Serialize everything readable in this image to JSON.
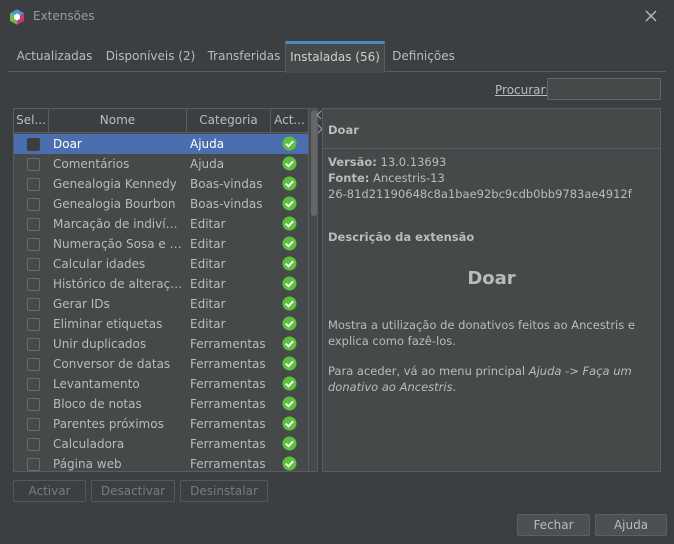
{
  "window": {
    "title": "Extensões"
  },
  "tabs": [
    {
      "label": "Actualizadas"
    },
    {
      "label": "Disponíveis (2)"
    },
    {
      "label": "Transferidas"
    },
    {
      "label": "Instaladas (56)"
    },
    {
      "label": "Definições"
    }
  ],
  "search": {
    "label": "Procurar:",
    "value": ""
  },
  "table": {
    "columns": [
      "Sel...",
      "Nome",
      "Categoria",
      "Act..."
    ],
    "rows": [
      {
        "name": "Doar",
        "category": "Ajuda",
        "selected": true
      },
      {
        "name": "Comentários",
        "category": "Ajuda"
      },
      {
        "name": "Genealogia Kennedy",
        "category": "Boas-vindas"
      },
      {
        "name": "Genealogia Bourbon",
        "category": "Boas-vindas"
      },
      {
        "name": "Marcação de indivíduo...",
        "category": "Editar"
      },
      {
        "name": "Numeração Sosa e d'A...",
        "category": "Editar"
      },
      {
        "name": "Calcular idades",
        "category": "Editar"
      },
      {
        "name": "Histórico de alterações",
        "category": "Editar"
      },
      {
        "name": "Gerar IDs",
        "category": "Editar"
      },
      {
        "name": "Eliminar etiquetas",
        "category": "Editar"
      },
      {
        "name": "Unir duplicados",
        "category": "Ferramentas"
      },
      {
        "name": "Conversor de datas",
        "category": "Ferramentas"
      },
      {
        "name": "Levantamento",
        "category": "Ferramentas"
      },
      {
        "name": "Bloco de notas",
        "category": "Ferramentas"
      },
      {
        "name": "Parentes próximos",
        "category": "Ferramentas"
      },
      {
        "name": "Calculadora",
        "category": "Ferramentas"
      },
      {
        "name": "Página web",
        "category": "Ferramentas"
      }
    ]
  },
  "detail": {
    "header": "Doar",
    "version_label": "Versão:",
    "version_value": "13.0.13693",
    "source_label": "Fonte:",
    "source_value": "Ancestris-13",
    "hash": "26-81d21190648c8a1bae92bc9cdb0bb9783ae4912f",
    "description_heading": "Descrição da extensão",
    "big_title": "Doar",
    "paragraph1": "Mostra a utilização de donativos feitos ao Ancestris e explica como fazê-los.",
    "paragraph2_prefix": "Para aceder, vá ao menu principal ",
    "paragraph2_italic": "Ajuda -> Faça um donativo ao Ancestris",
    "paragraph2_suffix": "."
  },
  "buttons": {
    "activate": "Activar",
    "deactivate": "Desactivar",
    "uninstall": "Desinstalar",
    "close": "Fechar",
    "help": "Ajuda"
  },
  "colors": {
    "accent": "#4a88c7",
    "selection": "#4b6eaf",
    "check": "#5fbf3e"
  }
}
